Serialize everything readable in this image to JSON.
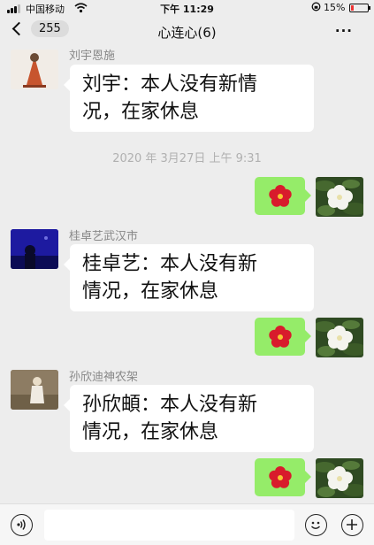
{
  "status_bar": {
    "carrier": "中国移动",
    "time": "下午 11:29",
    "battery": "15%"
  },
  "nav": {
    "back_count": "255",
    "title": "心连心(6)",
    "more": "···"
  },
  "timestamp": "2020 年 3月27日 上午 9:31",
  "messages": [
    {
      "sender": "刘宇恩施",
      "text_lines": [
        "刘宇：本人没有新情",
        "况，在家休息"
      ]
    },
    {
      "sender": "桂卓艺武汉市",
      "text_lines": [
        "桂卓艺：本人没有新",
        "情况，在家休息"
      ]
    },
    {
      "sender": "孙欣迪神农架",
      "text_lines": [
        "孙欣頔：本人没有新",
        "情况，在家休息"
      ]
    }
  ],
  "colors": {
    "background": "#ededed",
    "outgoing_bubble": "#95ec69",
    "incoming_bubble": "#ffffff",
    "sender_name": "#888888",
    "timestamp": "#b0b0b0"
  },
  "icons": {
    "outgoing_sticker": "red-flower-icon",
    "outgoing_avatar": "white-flower-avatar",
    "voice": "voice-icon",
    "emoji": "emoji-icon",
    "plus": "plus-icon"
  }
}
